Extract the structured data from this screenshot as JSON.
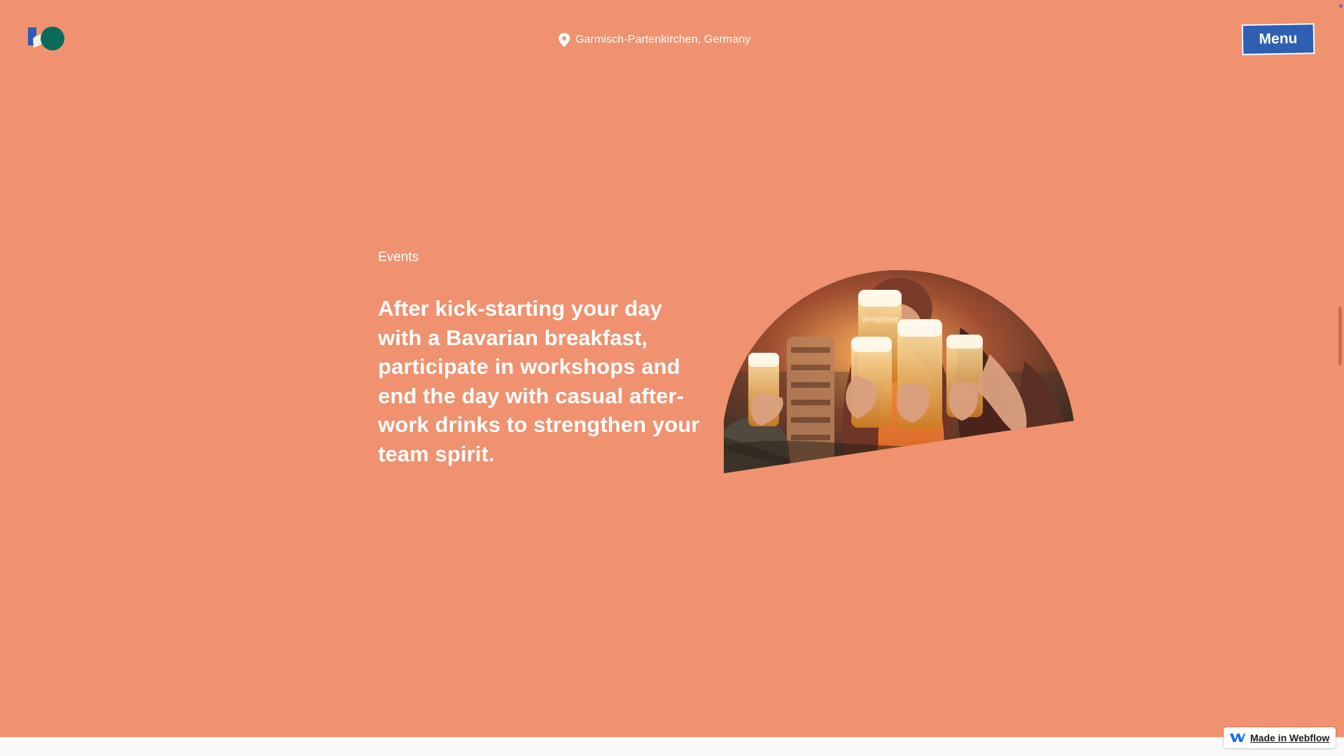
{
  "header": {
    "logo_name": "site-logo",
    "location": {
      "icon": "map-pin-icon",
      "text": "Garmisch-Partenkirchen, Germany"
    },
    "menu_label": "Menu"
  },
  "section": {
    "eyebrow": "Events",
    "headline": "After kick-starting your day with a Bavarian breakfast, participate in workshops and end the day with casual after-work drinks to strengthen your team spirit.",
    "image": "people-toasting-beer-photo"
  },
  "badge": {
    "icon": "webflow-logo-icon",
    "label": "Made in Webflow"
  },
  "colors": {
    "background": "#f0916f",
    "menu_button": "#2f5fb3",
    "text": "#ffffff",
    "footer_strip": "#fbfaf8"
  }
}
